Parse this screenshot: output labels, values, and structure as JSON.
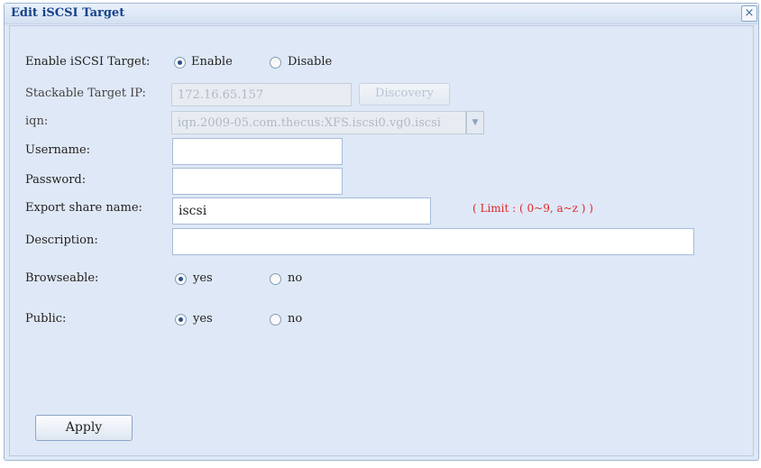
{
  "dialog": {
    "title": "Edit iSCSI Target",
    "close_glyph": "×"
  },
  "form": {
    "enable_target": {
      "label": "Enable iSCSI Target:",
      "options": [
        "Enable",
        "Disable"
      ],
      "selected": "Enable"
    },
    "stackable_ip": {
      "label": "Stackable Target IP:",
      "value": "172.16.65.157",
      "button": "Discovery"
    },
    "iqn": {
      "label": "iqn:",
      "value": "iqn.2009-05.com.thecus:XFS.iscsi0.vg0.iscsi",
      "arrow_icon": "chevron-down-icon"
    },
    "username": {
      "label": "Username:",
      "value": ""
    },
    "password": {
      "label": "Password:",
      "value": ""
    },
    "export_share": {
      "label": "Export share name:",
      "value": "iscsi",
      "hint": "( Limit : ( 0~9, a~z ) )"
    },
    "description": {
      "label": "Description:",
      "value": ""
    },
    "browseable": {
      "label": "Browseable:",
      "options": [
        "yes",
        "no"
      ],
      "selected": "yes"
    },
    "public": {
      "label": "Public:",
      "options": [
        "yes",
        "no"
      ],
      "selected": "yes"
    },
    "apply_button": "Apply"
  },
  "colors": {
    "accent": "#15428b",
    "background": "#dfe8f6",
    "hint": "#e0262a"
  }
}
